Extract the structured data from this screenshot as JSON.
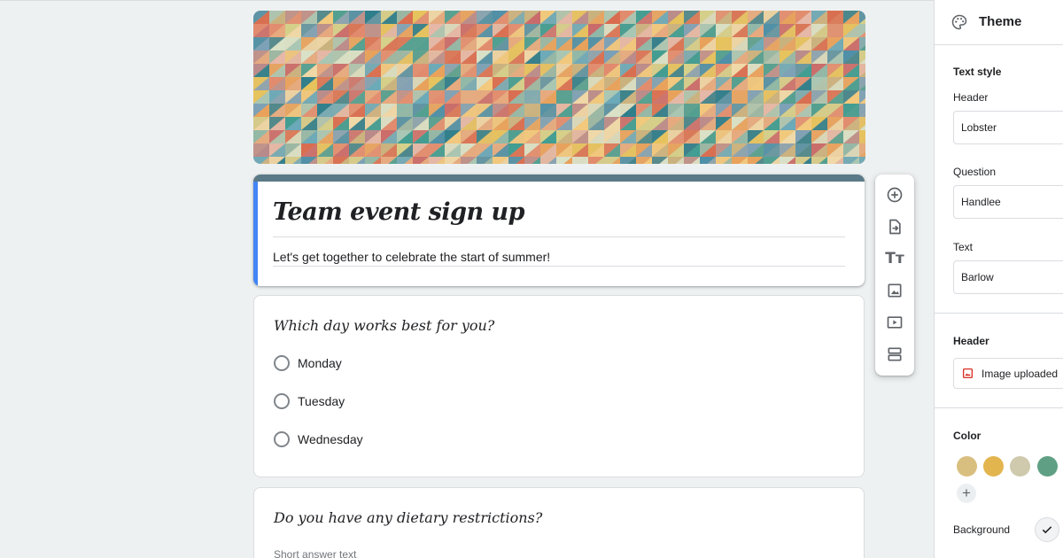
{
  "form": {
    "title": "Team event sign up",
    "description": "Let's get together to celebrate the start of summer!",
    "accent_color": "#4285f4",
    "header_bar_color": "#5b7a87"
  },
  "questions": [
    {
      "title": "Which day works best for you?",
      "type": "multiple-choice",
      "options": [
        "Monday",
        "Tuesday",
        "Wednesday"
      ]
    },
    {
      "title": "Do you have any dietary restrictions?",
      "type": "short-answer",
      "placeholder": "Short answer text"
    }
  ],
  "toolbar": {
    "icons": [
      "add-question-icon",
      "import-questions-icon",
      "add-title-icon",
      "add-image-icon",
      "add-video-icon",
      "add-section-icon"
    ]
  },
  "theme_panel": {
    "title": "Theme",
    "text_style_label": "Text style",
    "header_font_label": "Header",
    "header_font_value": "Lobster",
    "question_font_label": "Question",
    "question_font_value": "Handlee",
    "text_font_label": "Text",
    "text_font_value": "Barlow",
    "header_section_label": "Header",
    "header_image_label": "Image uploaded",
    "color_label": "Color",
    "colors": [
      "#d9bf7f",
      "#e3b54f",
      "#cfc9ad",
      "#5fa084"
    ],
    "background_label": "Background"
  }
}
